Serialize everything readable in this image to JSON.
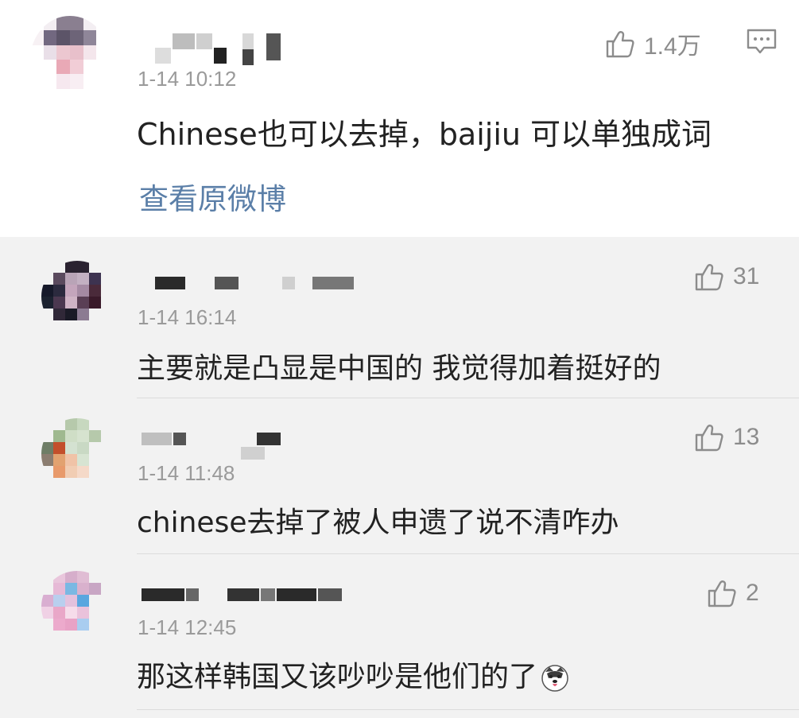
{
  "main_comment": {
    "time": "1-14 10:12",
    "text": "Chinese也可以去掉，baijiu 可以单独成词",
    "like_count": "1.4万",
    "view_original": "查看原微博"
  },
  "replies": [
    {
      "time": "1-14 16:14",
      "text": "主要就是凸显是中国的 我觉得加着挺好的",
      "like_count": "31"
    },
    {
      "time": "1-14 11:48",
      "text": "chinese去掉了被人申遗了说不清咋办",
      "like_count": "13"
    },
    {
      "time": "1-14 12:45",
      "text": "那这样韩国又该吵吵是他们的了",
      "like_count": "2",
      "emoji_icon": "doge-emoji-icon"
    }
  ],
  "colors": {
    "link": "#5b7fa8",
    "timestamp": "#9a9a9a",
    "reply_bg": "#f2f2f2"
  }
}
